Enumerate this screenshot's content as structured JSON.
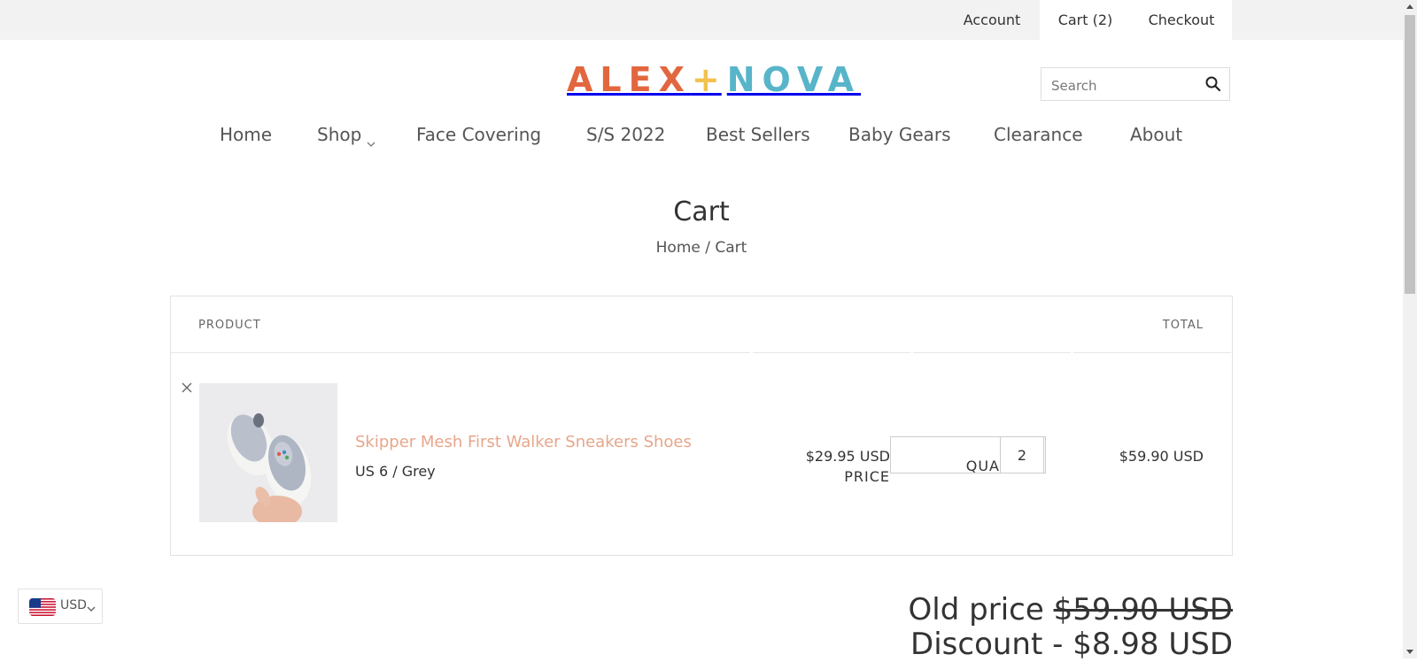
{
  "topbar": {
    "account": "Account",
    "cart": "Cart (2)",
    "checkout": "Checkout"
  },
  "logo": {
    "part1": "ALEX",
    "plus": "+",
    "part2": "NOVA"
  },
  "search": {
    "placeholder": "Search",
    "icon": "search-icon"
  },
  "nav": {
    "home": "Home",
    "shop": "Shop",
    "face_covering": "Face Covering",
    "ss2022": "S/S 2022",
    "best_sellers": "Best Sellers",
    "baby_gears": "Baby Gears",
    "clearance": "Clearance",
    "about": "About"
  },
  "page": {
    "title": "Cart",
    "breadcrumb_home": "Home",
    "breadcrumb_sep": "/",
    "breadcrumb_current": "Cart"
  },
  "cart_table": {
    "headers": {
      "product": "PRODUCT",
      "price": "PRICE",
      "quantity": "QUANTITY",
      "total": "TOTAL"
    },
    "items": [
      {
        "name": "Skipper Mesh First Walker Sneakers Shoes",
        "variant": "US 6 / Grey",
        "price": "$29.95 USD",
        "quantity": "2",
        "total": "$59.90 USD"
      }
    ]
  },
  "summary": {
    "old_price_label": "Old price",
    "old_price_value": "$59.90 USD",
    "discount_label": "Discount",
    "discount_sep": "-",
    "discount_value": "$8.98 USD"
  },
  "currency": {
    "code": "USD",
    "flag": "us-flag-icon"
  },
  "colors": {
    "logo_orange": "#e2673f",
    "logo_yellow": "#f2c14f",
    "logo_blue": "#58b5c9",
    "product_link": "#e7a68b",
    "topbar_bg": "#f2f2f2"
  }
}
